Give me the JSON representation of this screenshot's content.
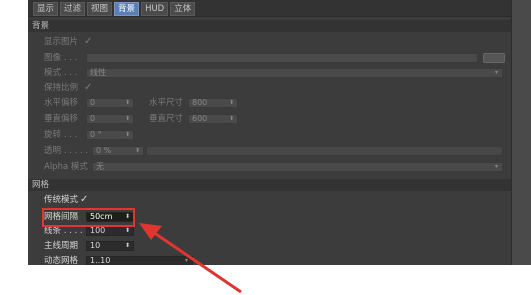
{
  "tabs": [
    "显示",
    "过滤",
    "视图",
    "背景",
    "HUD",
    "立体"
  ],
  "active_tab_index": 3,
  "background_section": {
    "title": "背景",
    "show_image_label": "显示图片",
    "show_image_checked": true,
    "image_label": "图像 . . .",
    "mode_label": "模式 . . .",
    "mode_value": "线性",
    "keep_ratio_label": "保持比例",
    "keep_ratio_checked": true,
    "h_offset_label": "水平偏移",
    "h_offset_value": "0",
    "h_size_label": "水平尺寸",
    "h_size_value": "800",
    "v_offset_label": "垂直偏移",
    "v_offset_value": "0",
    "v_size_label": "垂直尺寸",
    "v_size_value": "600",
    "rotate_label": "旋转 . . .",
    "rotate_value": "0 °",
    "transparency_label": "透明 . . . . .",
    "transparency_value": "0 %",
    "alpha_mode_label": "Alpha 模式",
    "alpha_mode_value": "无"
  },
  "grid_section": {
    "title": "网格",
    "legacy_mode_label": "传统模式",
    "legacy_mode_checked": true,
    "grid_spacing_label": "网格间隔",
    "grid_spacing_value": "50cm",
    "lines_label": "线条 . . . .",
    "lines_value": "100",
    "major_period_label": "主线周期",
    "major_period_value": "10",
    "dynamic_grid_label": "动态网格",
    "dynamic_grid_value": "1..10"
  },
  "icons": {
    "check": "✓",
    "spinner": "⬍",
    "dropdown": "▾"
  },
  "colors": {
    "highlight_box": "#e03530",
    "arrow": "#e03530",
    "active_tab": "#5b7fb4"
  }
}
